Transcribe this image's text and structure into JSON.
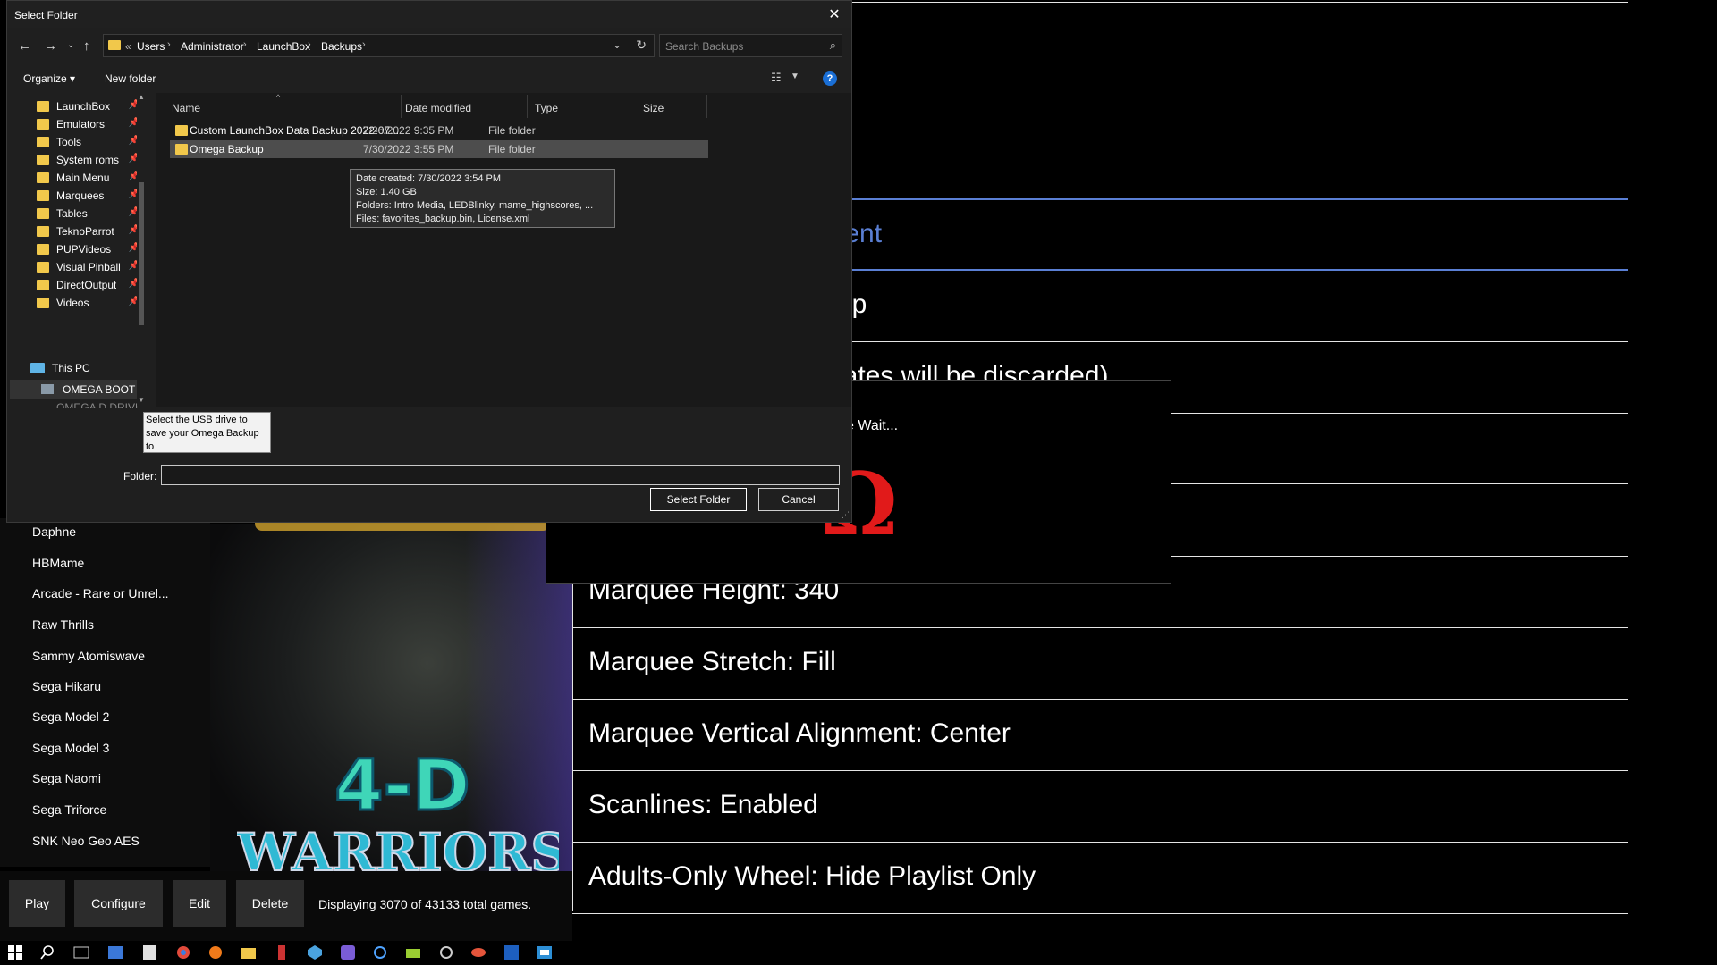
{
  "dialog": {
    "title": "Select Folder",
    "breadcrumb": [
      "Users",
      "Administrator",
      "LaunchBox",
      "Backups"
    ],
    "crumb_prefix": "«",
    "search_placeholder": "Search Backups",
    "organize_label": "Organize ▾",
    "new_folder_label": "New folder",
    "help_glyph": "?",
    "columns": [
      "Name",
      "Date modified",
      "Type",
      "Size"
    ],
    "files": [
      {
        "name": "Custom LaunchBox Data Backup 2022-07...",
        "date": "7/26/2022 9:35 PM",
        "type": "File folder"
      },
      {
        "name": "Omega Backup",
        "date": "7/30/2022 3:55 PM",
        "type": "File folder"
      }
    ],
    "tooltip": [
      "Date created: 7/30/2022 3:54 PM",
      "Size: 1.40 GB",
      "Folders: Intro Media, LEDBlinky, mame_highscores, ...",
      "Files: favorites_backup.bin, License.xml"
    ],
    "nav_items": [
      "LaunchBox",
      "Emulators",
      "Tools",
      "System roms",
      "Main Menu",
      "Marquees",
      "Tables",
      "TeknoParrot",
      "PUPVideos",
      "Visual Pinball",
      "DirectOutput",
      "Videos"
    ],
    "this_pc_label": "This PC",
    "omega_boot_label": "OMEGA BOOT D",
    "cut_item_label": "OMEGA D DRIVE",
    "help_tooltip": "Select the USB drive to save your Omega Backup to",
    "folder_label": "Folder:",
    "folder_value": "",
    "select_folder_label": "Select Folder",
    "cancel_label": "Cancel"
  },
  "launchbox": {
    "platforms": [
      "Daphne",
      "HBMame",
      "Arcade - Rare or Unrel...",
      "Raw Thrills",
      "Sammy Atomiswave",
      "Sega Hikaru",
      "Sega Model 2",
      "Sega Model 3",
      "Sega Naomi",
      "Sega Triforce",
      "SNK Neo Geo AES"
    ],
    "buttons": [
      "Play",
      "Configure",
      "Edit",
      "Delete"
    ],
    "status": "Displaying 3070 of 43133 total games.",
    "game_logo_text": [
      "4-D",
      "WARRIORS"
    ]
  },
  "settings_menu": {
    "items": [
      {
        "label": "tent",
        "highlighted": true
      },
      {
        "label": "up",
        "highlighted": false
      },
      {
        "label": "lates will be discarded)",
        "highlighted": false
      },
      {
        "label": "",
        "highlighted": false
      },
      {
        "label": "",
        "highlighted": false
      },
      {
        "label": "Marquee Height: 340",
        "highlighted": false
      },
      {
        "label": "Marquee Stretch: Fill",
        "highlighted": false
      },
      {
        "label": "Marquee Vertical Alignment: Center",
        "highlighted": false
      },
      {
        "label": "Scanlines: Enabled",
        "highlighted": false
      },
      {
        "label": "Adults-Only Wheel: Hide Playlist Only",
        "highlighted": false
      }
    ],
    "highlight_color": "#5a7fd4"
  },
  "wait_popup": {
    "text": "e Wait...",
    "logo_glyph": "Ω",
    "logo_color": "#e11a1a"
  }
}
